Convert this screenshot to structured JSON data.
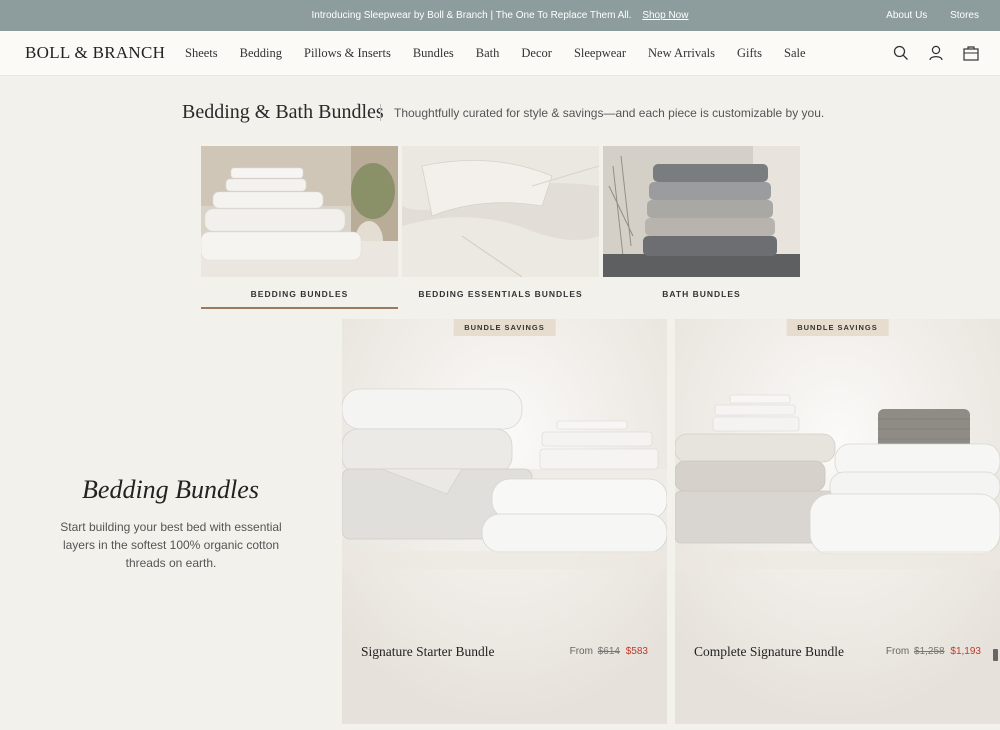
{
  "announcement": {
    "text": "Introducing Sleepwear by Boll & Branch | The One To Replace Them All.",
    "link": "Shop Now",
    "right_links": [
      "About Us",
      "Stores"
    ]
  },
  "header": {
    "logo": "BOLL & BRANCH",
    "nav": [
      "Sheets",
      "Bedding",
      "Pillows & Inserts",
      "Bundles",
      "Bath",
      "Decor",
      "Sleepwear",
      "New Arrivals",
      "Gifts",
      "Sale"
    ],
    "icons": [
      "search-icon",
      "account-icon",
      "bag-icon"
    ]
  },
  "section": {
    "title": "Bedding & Bath Bundles",
    "subtitle": "Thoughtfully curated for style & savings—and each piece is customizable by you."
  },
  "categories": [
    {
      "label": "BEDDING BUNDLES",
      "active": true
    },
    {
      "label": "BEDDING ESSENTIALS BUNDLES",
      "active": false
    },
    {
      "label": "BATH BUNDLES",
      "active": false
    }
  ],
  "promo": {
    "title": "Bedding Bundles",
    "description": "Start building your best bed with essential layers in the softest 100% organic cotton threads on earth."
  },
  "products": [
    {
      "badge": "BUNDLE SAVINGS",
      "name": "Signature Starter Bundle",
      "from": "From",
      "original": "$614",
      "sale": "$583"
    },
    {
      "badge": "BUNDLE SAVINGS",
      "name": "Complete Signature Bundle",
      "from": "From",
      "original": "$1,258",
      "sale": "$1,193"
    }
  ],
  "colors": {
    "announce_bg": "#8d9c9c",
    "accent_underline": "#9c7a62",
    "sale_red": "#c0392b",
    "page_bg": "#f3f1ec"
  }
}
